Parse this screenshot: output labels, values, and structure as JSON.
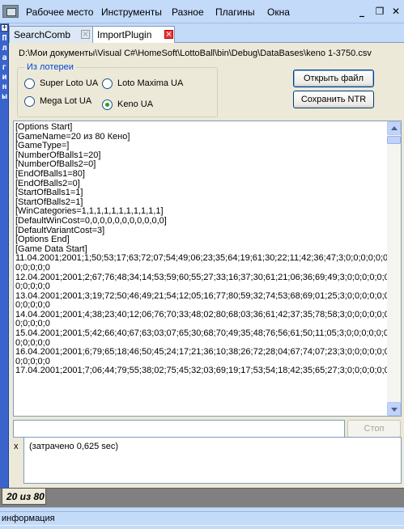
{
  "menubar": {
    "items": [
      "Рабочее место",
      "Инструменты",
      "Разное",
      "Плагины",
      "Окна"
    ],
    "window_controls": {
      "minimize_icon": "minimize-icon",
      "restore_icon": "restore-icon",
      "close_icon": "close-icon"
    }
  },
  "sidebar": {
    "collapse_icon": "+",
    "title_letters": [
      "П",
      "л",
      "а",
      "г",
      "и",
      "н",
      "ы"
    ]
  },
  "tabs": [
    {
      "label": "SearchComb",
      "active": false
    },
    {
      "label": "ImportPlugin",
      "active": true
    }
  ],
  "import": {
    "path": "D:\\Мои документы\\Visual C#\\HomeSoft\\LottoBall\\bin\\Debug\\DataBases\\keno 1-3750.csv",
    "lottery_group_label": "Из лотереи",
    "lotteries": [
      {
        "label": "Super Loto UA",
        "selected": false
      },
      {
        "label": "Loto Maxima UA",
        "selected": false
      },
      {
        "label": "Mega Lot UA",
        "selected": false
      },
      {
        "label": "Keno UA",
        "selected": true
      }
    ],
    "open_file_label": "Открыть файл",
    "save_ntr_label": "Сохранить NTR"
  },
  "content_lines": [
    "[Options Start]",
    "[GameName=20 из 80 Кено]",
    "[GameType=]",
    "[NumberOfBalls1=20]",
    "[NumberOfBalls2=0]",
    "[EndOfBalls1=80]",
    "[EndOfBalls2=0]",
    "[StartOfBalls1=1]",
    "[StartOfBalls2=1]",
    "[WinCategories=1,1,1,1,1,1,1,1,1,1,1]",
    "[DefaultWinCost=0,0,0,0,0,0,0,0,0,0,0]",
    "[DefaultVariantCost=3]",
    "[Options End]",
    "[Game Data Start]",
    "11.04.2001;2001;1;50;53;17;63;72;07;54;49;06;23;35;64;19;61;30;22;11;42;36;47;3;0;0;0;0;0;0;",
    "0;0;0;0;0",
    "12.04.2001;2001;2;67;76;48;34;14;53;59;60;55;27;33;16;37;30;61;21;06;36;69;49;3;0;0;0;0;0;0;",
    "0;0;0;0;0",
    "13.04.2001;2001;3;19;72;50;46;49;21;54;12;05;16;77;80;59;32;74;53;68;69;01;25;3;0;0;0;0;0;0;",
    "0;0;0;0;0",
    "14.04.2001;2001;4;38;23;40;12;06;76;70;33;48;02;80;68;03;36;61;42;37;35;78;58;3;0;0;0;0;0;0;",
    "0;0;0;0;0",
    "15.04.2001;2001;5;42;66;40;67;63;03;07;65;30;68;70;49;35;48;76;56;61;50;11;05;3;0;0;0;0;0;0;",
    "0;0;0;0;0",
    "16.04.2001;2001;6;79;65;18;46;50;45;24;17;21;36;10;38;26;72;28;04;67;74;07;23;3;0;0;0;0;0;0;",
    "0;0;0;0;0",
    "17.04.2001;2001;7;06;44;79;55;38;02;75;45;32;03;69;19;17;53;54;18;42;35;65;27;3;0;0;0;0;0;0;"
  ],
  "command": {
    "input_value": "",
    "stop_label": "Стоп"
  },
  "log": {
    "marker": "x",
    "text": "(затрачено 0,625 sec)"
  },
  "doc_tabs": [
    {
      "label": "20 из 80"
    }
  ],
  "statusbar": {
    "text": "информация"
  }
}
